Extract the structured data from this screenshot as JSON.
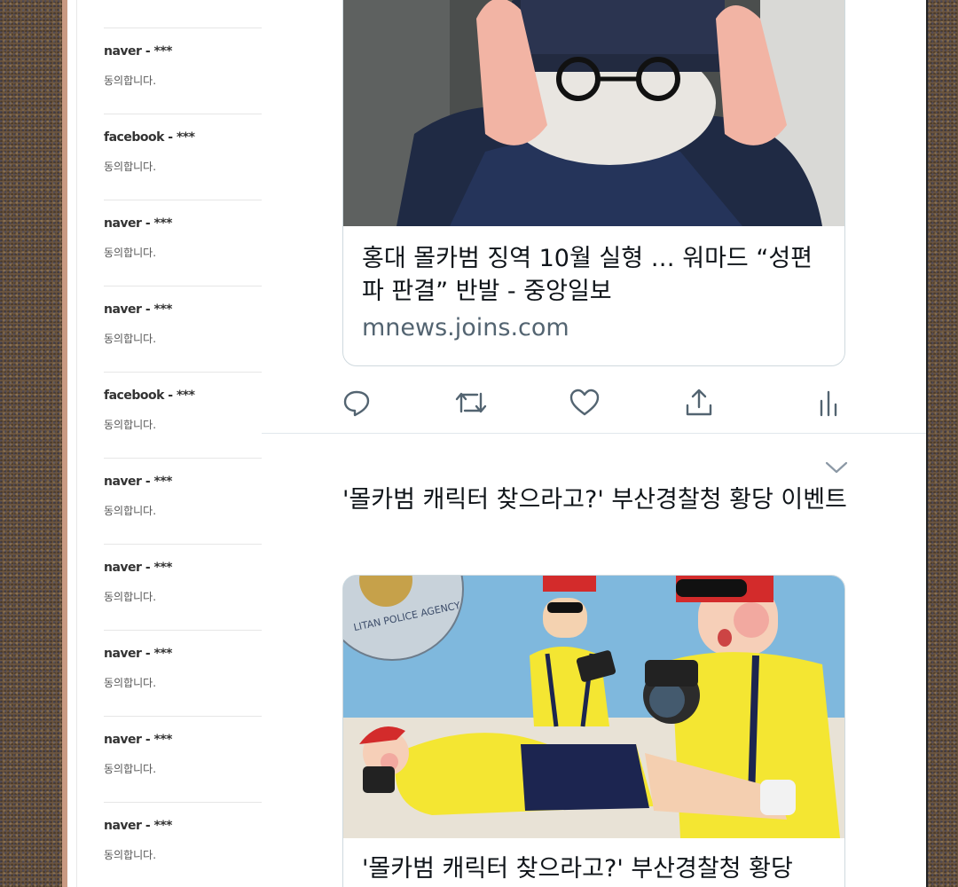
{
  "comments": [
    {
      "author": "naver - ***",
      "text": "동의합니다."
    },
    {
      "author": "facebook - ***",
      "text": "동의합니다."
    },
    {
      "author": "naver - ***",
      "text": "동의합니다."
    },
    {
      "author": "naver - ***",
      "text": "동의합니다."
    },
    {
      "author": "facebook - ***",
      "text": "동의합니다."
    },
    {
      "author": "naver - ***",
      "text": "동의합니다."
    },
    {
      "author": "naver - ***",
      "text": "동의합니다."
    },
    {
      "author": "naver - ***",
      "text": "동의합니다."
    },
    {
      "author": "naver - ***",
      "text": "동의합니다."
    },
    {
      "author": "naver - ***",
      "text": "동의합니다."
    }
  ],
  "tweet1": {
    "card_title": "홍대 몰카범 징역 10월 실형 … 워마드 “성편파 판결” 반발 - 중앙일보",
    "card_domain": "mnews.joins.com"
  },
  "actions": {
    "icons": [
      "reply-icon",
      "retweet-icon",
      "like-icon",
      "share-icon",
      "analytics-icon"
    ],
    "color": "#536471"
  },
  "tweet2": {
    "text": "'몰카범 캐릭터 찾으라고?' 부산경찰청 황당 이벤트",
    "card_title": "'몰카범 캐릭터 찾으라고?' 부산경찰청 황당",
    "seal_text": "LITAN POLICE AGENCY"
  },
  "colors": {
    "text": "#0f1419",
    "secondary": "#536471",
    "border": "#cfd9de"
  }
}
